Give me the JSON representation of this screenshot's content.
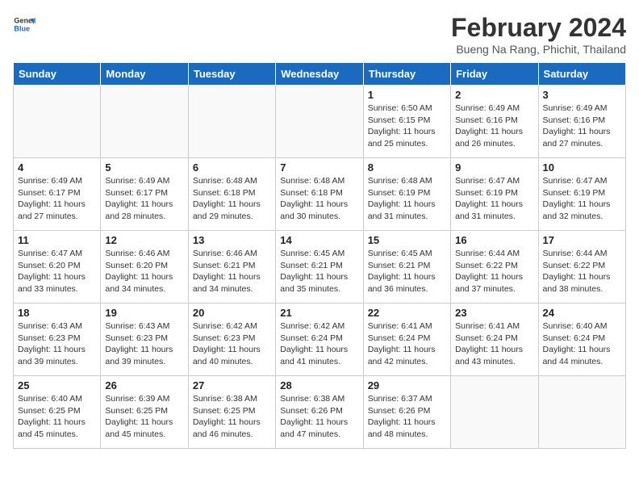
{
  "header": {
    "logo_general": "General",
    "logo_blue": "Blue",
    "month": "February 2024",
    "location": "Bueng Na Rang, Phichit, Thailand"
  },
  "days_of_week": [
    "Sunday",
    "Monday",
    "Tuesday",
    "Wednesday",
    "Thursday",
    "Friday",
    "Saturday"
  ],
  "weeks": [
    [
      {
        "day": "",
        "info": ""
      },
      {
        "day": "",
        "info": ""
      },
      {
        "day": "",
        "info": ""
      },
      {
        "day": "",
        "info": ""
      },
      {
        "day": "1",
        "info": "Sunrise: 6:50 AM\nSunset: 6:15 PM\nDaylight: 11 hours\nand 25 minutes."
      },
      {
        "day": "2",
        "info": "Sunrise: 6:49 AM\nSunset: 6:16 PM\nDaylight: 11 hours\nand 26 minutes."
      },
      {
        "day": "3",
        "info": "Sunrise: 6:49 AM\nSunset: 6:16 PM\nDaylight: 11 hours\nand 27 minutes."
      }
    ],
    [
      {
        "day": "4",
        "info": "Sunrise: 6:49 AM\nSunset: 6:17 PM\nDaylight: 11 hours\nand 27 minutes."
      },
      {
        "day": "5",
        "info": "Sunrise: 6:49 AM\nSunset: 6:17 PM\nDaylight: 11 hours\nand 28 minutes."
      },
      {
        "day": "6",
        "info": "Sunrise: 6:48 AM\nSunset: 6:18 PM\nDaylight: 11 hours\nand 29 minutes."
      },
      {
        "day": "7",
        "info": "Sunrise: 6:48 AM\nSunset: 6:18 PM\nDaylight: 11 hours\nand 30 minutes."
      },
      {
        "day": "8",
        "info": "Sunrise: 6:48 AM\nSunset: 6:19 PM\nDaylight: 11 hours\nand 31 minutes."
      },
      {
        "day": "9",
        "info": "Sunrise: 6:47 AM\nSunset: 6:19 PM\nDaylight: 11 hours\nand 31 minutes."
      },
      {
        "day": "10",
        "info": "Sunrise: 6:47 AM\nSunset: 6:19 PM\nDaylight: 11 hours\nand 32 minutes."
      }
    ],
    [
      {
        "day": "11",
        "info": "Sunrise: 6:47 AM\nSunset: 6:20 PM\nDaylight: 11 hours\nand 33 minutes."
      },
      {
        "day": "12",
        "info": "Sunrise: 6:46 AM\nSunset: 6:20 PM\nDaylight: 11 hours\nand 34 minutes."
      },
      {
        "day": "13",
        "info": "Sunrise: 6:46 AM\nSunset: 6:21 PM\nDaylight: 11 hours\nand 34 minutes."
      },
      {
        "day": "14",
        "info": "Sunrise: 6:45 AM\nSunset: 6:21 PM\nDaylight: 11 hours\nand 35 minutes."
      },
      {
        "day": "15",
        "info": "Sunrise: 6:45 AM\nSunset: 6:21 PM\nDaylight: 11 hours\nand 36 minutes."
      },
      {
        "day": "16",
        "info": "Sunrise: 6:44 AM\nSunset: 6:22 PM\nDaylight: 11 hours\nand 37 minutes."
      },
      {
        "day": "17",
        "info": "Sunrise: 6:44 AM\nSunset: 6:22 PM\nDaylight: 11 hours\nand 38 minutes."
      }
    ],
    [
      {
        "day": "18",
        "info": "Sunrise: 6:43 AM\nSunset: 6:23 PM\nDaylight: 11 hours\nand 39 minutes."
      },
      {
        "day": "19",
        "info": "Sunrise: 6:43 AM\nSunset: 6:23 PM\nDaylight: 11 hours\nand 39 minutes."
      },
      {
        "day": "20",
        "info": "Sunrise: 6:42 AM\nSunset: 6:23 PM\nDaylight: 11 hours\nand 40 minutes."
      },
      {
        "day": "21",
        "info": "Sunrise: 6:42 AM\nSunset: 6:24 PM\nDaylight: 11 hours\nand 41 minutes."
      },
      {
        "day": "22",
        "info": "Sunrise: 6:41 AM\nSunset: 6:24 PM\nDaylight: 11 hours\nand 42 minutes."
      },
      {
        "day": "23",
        "info": "Sunrise: 6:41 AM\nSunset: 6:24 PM\nDaylight: 11 hours\nand 43 minutes."
      },
      {
        "day": "24",
        "info": "Sunrise: 6:40 AM\nSunset: 6:24 PM\nDaylight: 11 hours\nand 44 minutes."
      }
    ],
    [
      {
        "day": "25",
        "info": "Sunrise: 6:40 AM\nSunset: 6:25 PM\nDaylight: 11 hours\nand 45 minutes."
      },
      {
        "day": "26",
        "info": "Sunrise: 6:39 AM\nSunset: 6:25 PM\nDaylight: 11 hours\nand 45 minutes."
      },
      {
        "day": "27",
        "info": "Sunrise: 6:38 AM\nSunset: 6:25 PM\nDaylight: 11 hours\nand 46 minutes."
      },
      {
        "day": "28",
        "info": "Sunrise: 6:38 AM\nSunset: 6:26 PM\nDaylight: 11 hours\nand 47 minutes."
      },
      {
        "day": "29",
        "info": "Sunrise: 6:37 AM\nSunset: 6:26 PM\nDaylight: 11 hours\nand 48 minutes."
      },
      {
        "day": "",
        "info": ""
      },
      {
        "day": "",
        "info": ""
      }
    ]
  ]
}
